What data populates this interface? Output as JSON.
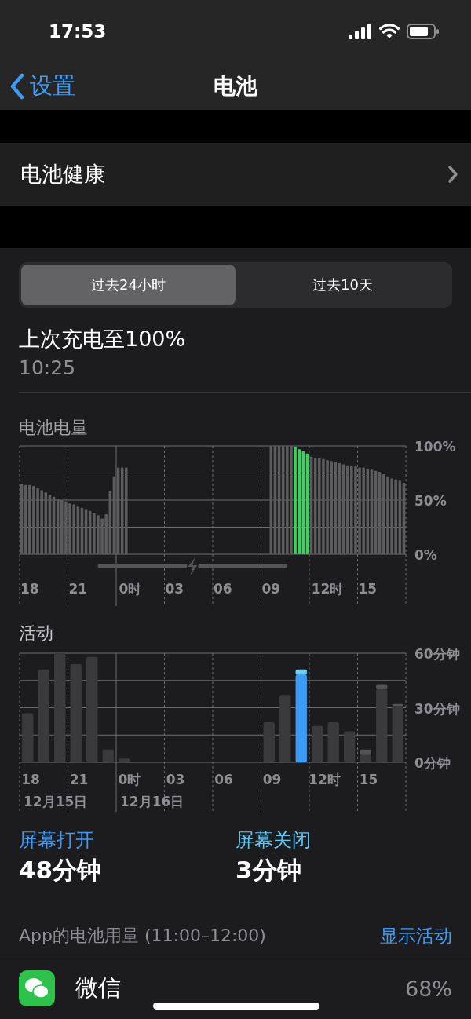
{
  "status_bar": {
    "time": "17:53"
  },
  "nav": {
    "back": "设置",
    "title": "电池"
  },
  "health_row": {
    "label": "电池健康"
  },
  "range_tabs": [
    {
      "label": "过去24小时",
      "selected": true
    },
    {
      "label": "过去10天",
      "selected": false
    }
  ],
  "last_charge": {
    "title": "上次充电至100%",
    "time": "10:25"
  },
  "battery_chart": {
    "title": "电池电量",
    "chart_data": {
      "type": "bar",
      "grid": true,
      "ylim": [
        0,
        100
      ],
      "categories": [
        null,
        null,
        "18",
        null,
        null,
        null,
        null,
        null,
        null,
        null,
        null,
        null,
        null,
        null,
        "21",
        null,
        null,
        null,
        null,
        null,
        null,
        null,
        null,
        null,
        null,
        null,
        null,
        "0时",
        null,
        null,
        null,
        null,
        null,
        null,
        null,
        null,
        null,
        null,
        "03",
        null,
        null,
        null,
        null,
        null,
        null,
        null,
        null,
        null,
        null,
        null,
        "06",
        null,
        null,
        null,
        null,
        null,
        null,
        null,
        null,
        null,
        null,
        null,
        "09",
        null,
        null,
        null,
        null,
        null,
        null,
        null,
        null,
        null,
        null,
        null,
        null,
        null,
        "12时",
        null,
        null,
        null,
        null,
        null,
        null,
        null,
        null,
        null,
        "15",
        null,
        null,
        null,
        null,
        null,
        null,
        null,
        null,
        null
      ],
      "series": [
        {
          "color": "#5c5c5e",
          "values": [
            65,
            64,
            64,
            63,
            61,
            59,
            57,
            55,
            53,
            51,
            50,
            49,
            47,
            46,
            44,
            43,
            41,
            40,
            38,
            36,
            33,
            37,
            58,
            72,
            80,
            80,
            80,
            null,
            null,
            null,
            null,
            null,
            null,
            null,
            null,
            null,
            null,
            null,
            null,
            null,
            null,
            null,
            null,
            null,
            null,
            null,
            null,
            null,
            null,
            null,
            null,
            null,
            null,
            null,
            null,
            null,
            null,
            null,
            null,
            null,
            null,
            null,
            100,
            100,
            100,
            100,
            100,
            100,
            null,
            null,
            null,
            null,
            90,
            89,
            89,
            88,
            87,
            86,
            85,
            84,
            83,
            82,
            82,
            81,
            80,
            80,
            79,
            78,
            77,
            76,
            74,
            72,
            70,
            69,
            68,
            66
          ]
        },
        {
          "color": "#35d75a",
          "values": [
            null,
            null,
            null,
            null,
            null,
            null,
            null,
            null,
            null,
            null,
            null,
            null,
            null,
            null,
            null,
            null,
            null,
            null,
            null,
            null,
            null,
            null,
            null,
            null,
            null,
            null,
            null,
            null,
            null,
            null,
            null,
            null,
            null,
            null,
            null,
            null,
            null,
            null,
            null,
            null,
            null,
            null,
            null,
            null,
            null,
            null,
            null,
            null,
            null,
            null,
            null,
            null,
            null,
            null,
            null,
            null,
            null,
            null,
            null,
            null,
            null,
            null,
            null,
            null,
            null,
            null,
            null,
            null,
            99,
            97,
            95,
            93,
            null,
            null,
            null,
            null,
            null,
            null,
            null,
            null,
            null,
            null,
            null,
            null,
            null,
            null,
            null,
            null,
            null,
            null,
            null,
            null,
            null,
            null,
            null,
            null
          ]
        }
      ],
      "yticks": [
        {
          "value": 0,
          "label": "0%"
        },
        {
          "value": 50,
          "label": "50%"
        },
        {
          "value": 100,
          "label": "100%"
        }
      ]
    }
  },
  "activity_chart": {
    "title": "活动",
    "chart_data": {
      "type": "bar",
      "stacked": true,
      "grid": true,
      "ylim": [
        0,
        60
      ],
      "categories": [
        "18",
        null,
        null,
        "21",
        null,
        null,
        "0时",
        null,
        null,
        "03",
        null,
        null,
        "06",
        null,
        null,
        "09",
        null,
        null,
        "12时",
        null,
        null,
        "15",
        null,
        null
      ],
      "series": [
        {
          "color": "#3a3a3c",
          "values": [
            27,
            51,
            60,
            54,
            58,
            7,
            2,
            0,
            0,
            0,
            0,
            0,
            0,
            0,
            0,
            22,
            37,
            null,
            20,
            22,
            17,
            4,
            40,
            31
          ]
        },
        {
          "color": "#545456",
          "values": [
            null,
            null,
            null,
            null,
            null,
            null,
            null,
            null,
            null,
            null,
            null,
            null,
            null,
            null,
            null,
            null,
            null,
            null,
            null,
            null,
            null,
            3,
            3,
            1
          ]
        },
        {
          "color": "#3b9cf6",
          "values": [
            null,
            null,
            null,
            null,
            null,
            null,
            null,
            null,
            null,
            null,
            null,
            null,
            null,
            null,
            null,
            null,
            null,
            48,
            null,
            null,
            null,
            null,
            null,
            null
          ]
        },
        {
          "color": "#6ad0fb",
          "values": [
            null,
            null,
            null,
            null,
            null,
            null,
            null,
            null,
            null,
            null,
            null,
            null,
            null,
            null,
            null,
            null,
            null,
            3,
            null,
            null,
            null,
            null,
            null,
            null
          ]
        }
      ],
      "yticks": [
        {
          "value": 0,
          "label": "0分钟"
        },
        {
          "value": 30,
          "label": "30分钟"
        },
        {
          "value": 60,
          "label": "60分钟"
        }
      ],
      "annotations": [
        "12月15日",
        "12月16日"
      ]
    }
  },
  "screen_stats": [
    {
      "label": "屏幕打开",
      "value": "48分钟",
      "color": "#3d9bf5"
    },
    {
      "label": "屏幕关闭",
      "value": "3分钟",
      "color": "#5ac8f5"
    }
  ],
  "app_usage": {
    "title": "App的电池用量 (11:00–12:00)",
    "action": "显示活动",
    "apps": [
      {
        "name": "微信",
        "percent": "68%"
      }
    ]
  }
}
